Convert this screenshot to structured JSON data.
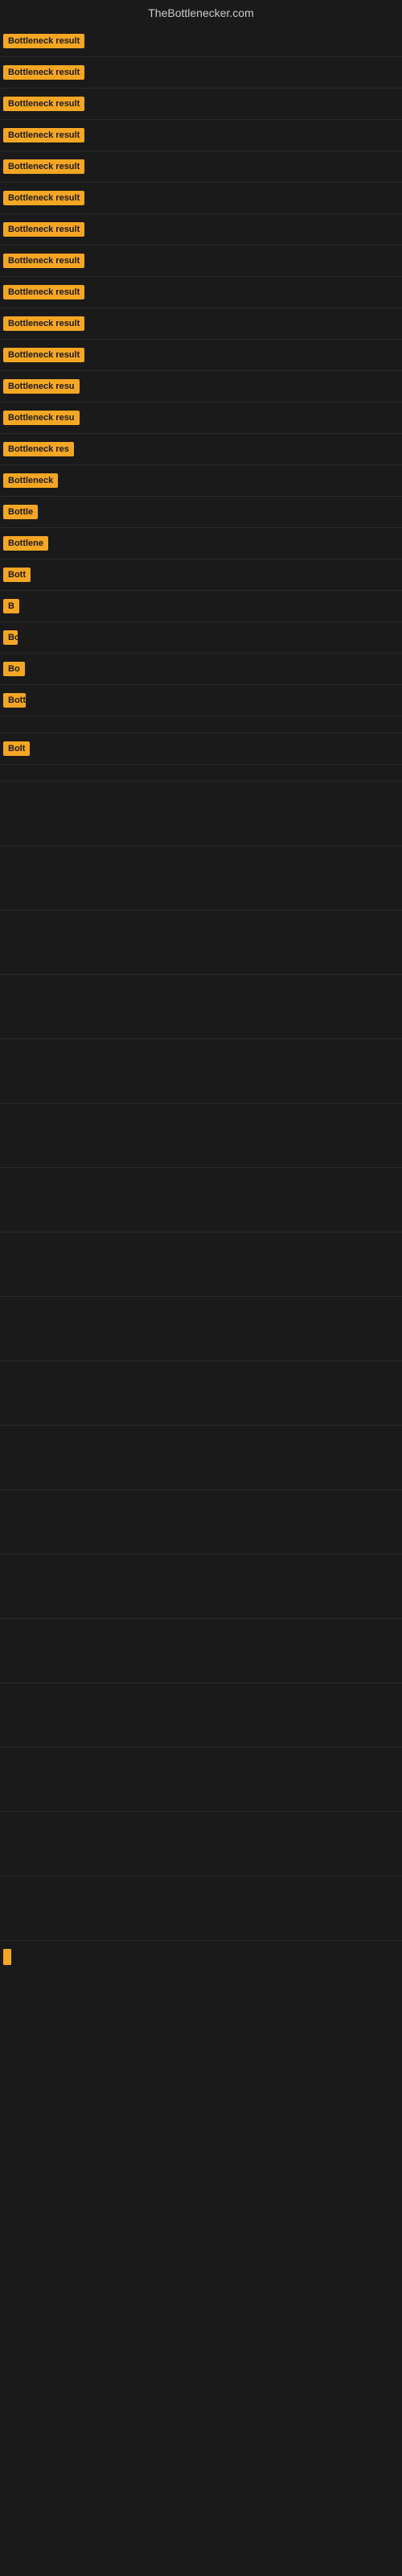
{
  "site": {
    "title": "TheBottlenecker.com"
  },
  "colors": {
    "badge_bg": "#f5a623",
    "badge_text": "#1a1a1a",
    "page_bg": "#1a1a1a"
  },
  "rows": [
    {
      "id": 0,
      "label": "Bottleneck result"
    },
    {
      "id": 1,
      "label": "Bottleneck result"
    },
    {
      "id": 2,
      "label": "Bottleneck result"
    },
    {
      "id": 3,
      "label": "Bottleneck result"
    },
    {
      "id": 4,
      "label": "Bottleneck result"
    },
    {
      "id": 5,
      "label": "Bottleneck result"
    },
    {
      "id": 6,
      "label": "Bottleneck result"
    },
    {
      "id": 7,
      "label": "Bottleneck result"
    },
    {
      "id": 8,
      "label": "Bottleneck result"
    },
    {
      "id": 9,
      "label": "Bottleneck result"
    },
    {
      "id": 10,
      "label": "Bottleneck result"
    },
    {
      "id": 11,
      "label": "Bottleneck resu"
    },
    {
      "id": 12,
      "label": "Bottleneck resu"
    },
    {
      "id": 13,
      "label": "Bottleneck res"
    },
    {
      "id": 14,
      "label": "Bottleneck"
    },
    {
      "id": 15,
      "label": "Bottle"
    },
    {
      "id": 16,
      "label": "Bottlene"
    },
    {
      "id": 17,
      "label": "Bott"
    },
    {
      "id": 18,
      "label": "B"
    },
    {
      "id": 19,
      "label": "Bott"
    },
    {
      "id": 20,
      "label": "Bo"
    },
    {
      "id": 21,
      "label": "Bottler"
    },
    {
      "id": 22,
      "label": ""
    },
    {
      "id": 23,
      "label": "Bolt"
    },
    {
      "id": 24,
      "label": ""
    }
  ],
  "empty_rows_count": 18
}
